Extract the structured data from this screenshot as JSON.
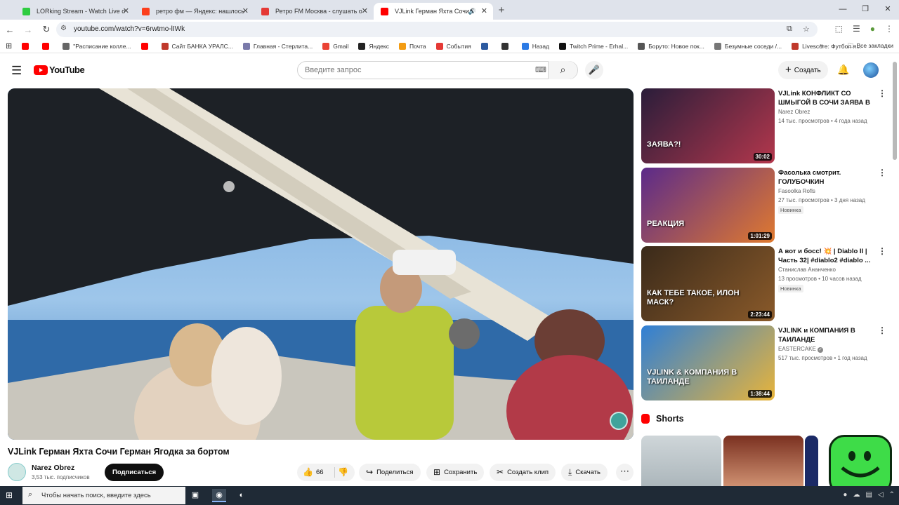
{
  "browser": {
    "tabs": [
      {
        "title": "LORking Stream - Watch Live o",
        "favicon_color": "#2ecc40",
        "active": false
      },
      {
        "title": "ретро фм — Яндекс: нашлось",
        "favicon_color": "#fc3f1d",
        "active": false
      },
      {
        "title": "Ретро FM Москва - слушать о",
        "favicon_color": "#e53935",
        "active": false
      },
      {
        "title": "VJLink Герман Яхта Сочи Г",
        "favicon_color": "#ff0000",
        "active": true
      }
    ],
    "url": "youtube.com/watch?v=6rwtmo-lIWk",
    "bookmarks": [
      {
        "label": "",
        "color": "#ff0000"
      },
      {
        "label": "",
        "color": "#ff0000"
      },
      {
        "label": "\"Расписание колле...",
        "color": "#666"
      },
      {
        "label": "",
        "color": "#ff0000"
      },
      {
        "label": "Сайт БАНКА УРАЛС...",
        "color": "#c0392b"
      },
      {
        "label": "Главная - Стерлита...",
        "color": "#7a7aaa"
      },
      {
        "label": "Gmail",
        "color": "#ea4335"
      },
      {
        "label": "Яндекс",
        "color": "#222"
      },
      {
        "label": "Почта",
        "color": "#f39c12"
      },
      {
        "label": "События",
        "color": "#e53935"
      },
      {
        "label": "",
        "color": "#2c5aa0"
      },
      {
        "label": "",
        "color": "#333"
      },
      {
        "label": "Назад",
        "color": "#2c7be5"
      },
      {
        "label": "Twitch Prime - Erhal...",
        "color": "#111"
      },
      {
        "label": "Боруто: Новое пок...",
        "color": "#555"
      },
      {
        "label": "Безумные соседи /...",
        "color": "#777"
      },
      {
        "label": "Livescore: Футбол я...",
        "color": "#c0392b"
      }
    ],
    "all_bookmarks": "Все закладки"
  },
  "youtube": {
    "logo_text": "YouTube",
    "search_placeholder": "Введите запрос",
    "create_label": "Создать"
  },
  "video": {
    "title": "VJLink Герман Яхта Сочи Герман Ягодка за бортом",
    "channel": "Narez Obrez",
    "subscribers": "3,53 тыс. подписчиков",
    "subscribe_label": "Подписаться",
    "likes": "66",
    "share_label": "Поделиться",
    "save_label": "Сохранить",
    "clip_label": "Создать клип",
    "download_label": "Скачать"
  },
  "recommendations": [
    {
      "title": "VJLink КОНФЛИКТ СО ШМЫГОЙ В СОЧИ ЗАЯВА В ...",
      "channel": "Narez Obrez",
      "meta": "14 тыс. просмотров • 4 года назад",
      "duration": "30:02",
      "badge": "",
      "verified": false,
      "thumb_text": "ЗАЯВА?!",
      "colors": [
        "#2a1d3a",
        "#b3374c"
      ]
    },
    {
      "title": "Фасолька смотрит. ГОЛУБОЧКИН УНИЧТОЖАЕТ...",
      "channel": "Fasoolka Rofls",
      "meta": "27 тыс. просмотров • 3 дня назад",
      "duration": "1:01:29",
      "badge": "Новинка",
      "verified": false,
      "thumb_text": "РЕАКЦИЯ",
      "colors": [
        "#5b2a8a",
        "#e07a2f"
      ]
    },
    {
      "title": "А вот и босс! 💥 | Diablo II | Часть 32| #diablo2 #diablo ...",
      "channel": "Станислав Ананченко",
      "meta": "13 просмотров • 10 часов назад",
      "duration": "2:23:44",
      "badge": "Новинка",
      "verified": false,
      "thumb_text": "КАК ТЕБЕ ТАКОЕ, ИЛОН МАСК?",
      "colors": [
        "#3a2a1a",
        "#8a5a2a"
      ]
    },
    {
      "title": "VJLINK и КОМПАНИЯ В ТАИЛАНДЕ",
      "channel": "EASTERCAKE",
      "meta": "517 тыс. просмотров • 1 год назад",
      "duration": "1:38:44",
      "badge": "",
      "verified": true,
      "thumb_text": "VJLINK & КОМПАНИЯ В ТАИЛАНДЕ",
      "colors": [
        "#2f7fd6",
        "#e8b43a"
      ]
    }
  ],
  "shorts_label": "Shorts",
  "taskbar": {
    "search_text": "Чтобы начать поиск, введите здесь"
  }
}
